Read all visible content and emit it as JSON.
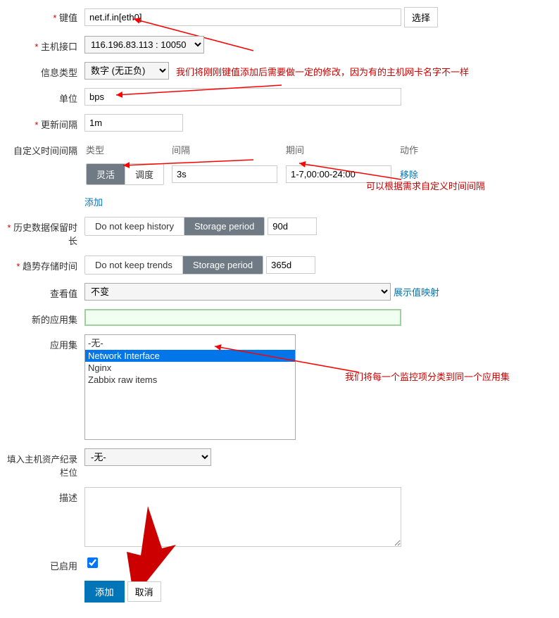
{
  "labels": {
    "key": "键值",
    "hostInterface": "主机接口",
    "infoType": "信息类型",
    "unit": "单位",
    "updateInterval": "更新间隔",
    "customIntervals": "自定义时间间隔",
    "historyRetention": "历史数据保留时长",
    "trendRetention": "趋势存储时间",
    "showValue": "查看值",
    "newApp": "新的应用集",
    "appSet": "应用集",
    "inventory": "填入主机资产纪录栏位",
    "description": "描述",
    "enabled": "已启用"
  },
  "values": {
    "key": "net.if.in[eth0]",
    "hostInterface": "116.196.83.113 : 10050",
    "infoType": "数字 (无正负)",
    "unit": "bps",
    "updateInterval": "1m",
    "historyDays": "90d",
    "trendDays": "365d",
    "showValue": "不变",
    "inventory": "-无-"
  },
  "buttons": {
    "select": "选择",
    "flexible": "灵活",
    "scheduling": "调度",
    "remove": "移除",
    "add": "添加",
    "noKeepHistory": "Do not keep history",
    "storagePeriod": "Storage period",
    "noKeepTrends": "Do not keep trends",
    "showValueMap": "展示值映射",
    "submit": "添加",
    "cancel": "取消"
  },
  "intervalHeaders": {
    "type": "类型",
    "interval": "间隔",
    "period": "期间",
    "action": "动作"
  },
  "intervalRow": {
    "interval": "3s",
    "period": "1-7,00:00-24:00"
  },
  "appOptions": [
    "-无-",
    "Network Interface",
    "Nginx",
    "Zabbix raw items"
  ],
  "annotations": {
    "a1": "我们将刚刚键值添加后需要做一定的修改，因为有的主机网卡名字不一样",
    "a2": "可以根据需求自定义时间间隔",
    "a3": "我们将每一个监控项分类到同一个应用集"
  }
}
